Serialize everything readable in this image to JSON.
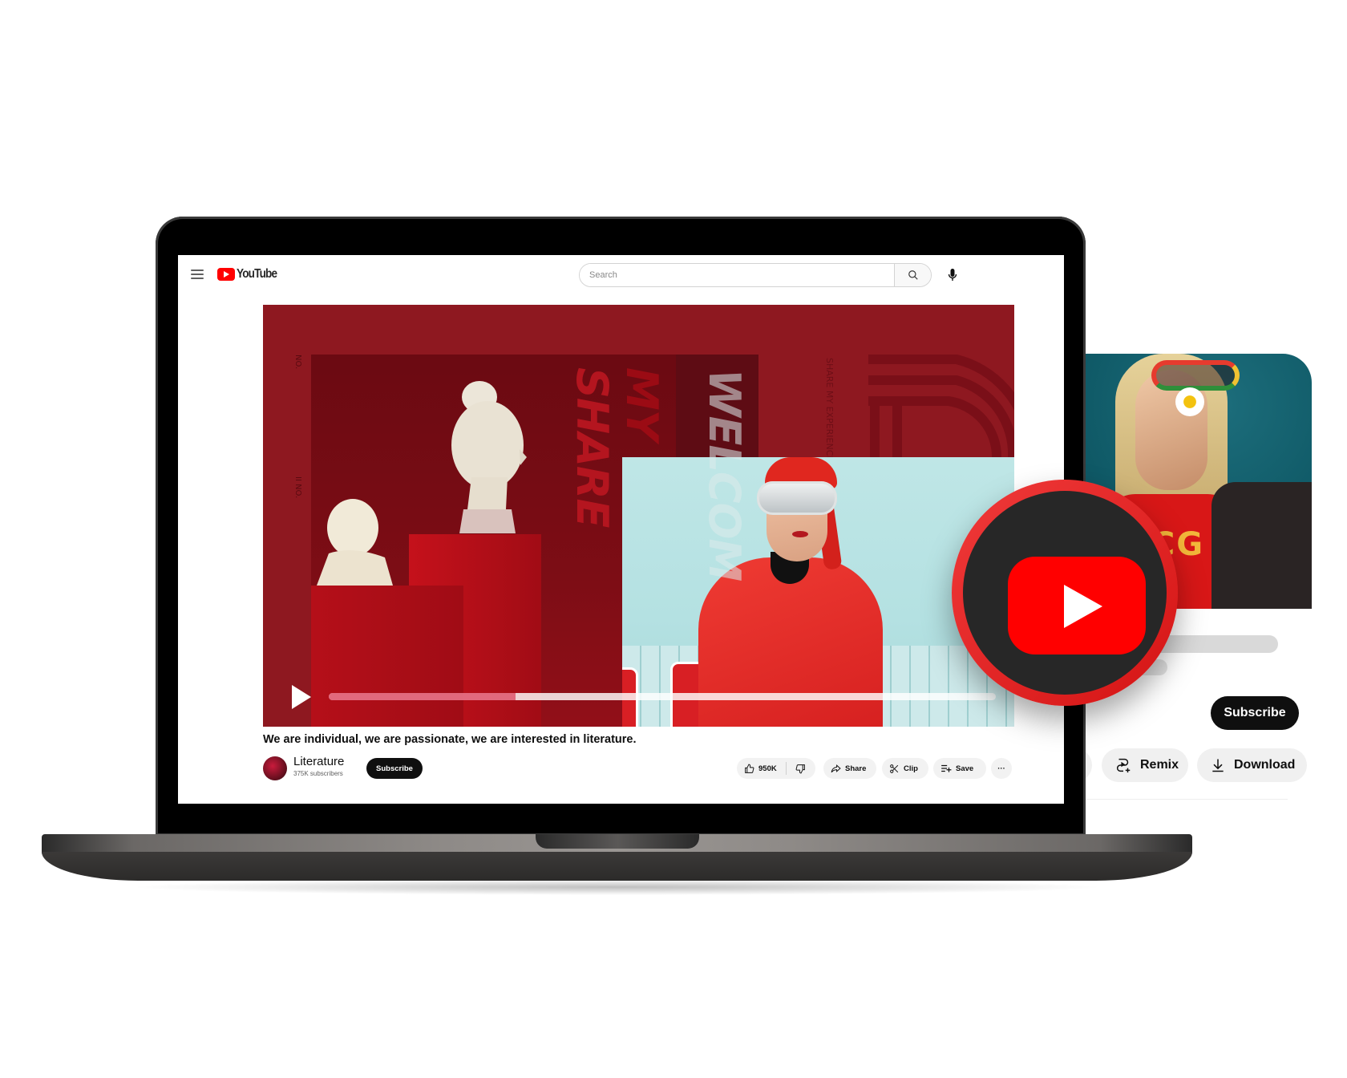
{
  "header": {
    "logo_text": "YouTube",
    "search_placeholder": "Search",
    "menu_icon": "hamburger-icon",
    "search_icon": "search-icon",
    "mic_icon": "microphone-icon"
  },
  "player": {
    "overlay_texts": {
      "my": "MY",
      "share": "SHARE",
      "welcome": "WELCOM",
      "no_1": "NO.",
      "no_2": "II NO.",
      "share_my_experience": "SHARE MY EXPERIENCE"
    },
    "progress_percent": 28,
    "play_icon": "play-icon"
  },
  "video": {
    "title": "We are individual, we are passionate, we are interested in literature.",
    "channel": {
      "name": "Literature",
      "subscribers": "375K subscribers",
      "subscribe_label": "Subscribe"
    },
    "actions": {
      "likes": "950K",
      "share": "Share",
      "clip": "Clip",
      "save": "Save",
      "more": "···"
    }
  },
  "side_card": {
    "subscribe_label": "Subscribe",
    "remix_label": "Remix",
    "download_label": "Download"
  },
  "colors": {
    "brand_red": "#ff0000",
    "player_bg": "#8e1820",
    "button_dark": "#0f0f0f",
    "chip_bg": "#f2f2f2",
    "badge_dark": "#272727"
  }
}
